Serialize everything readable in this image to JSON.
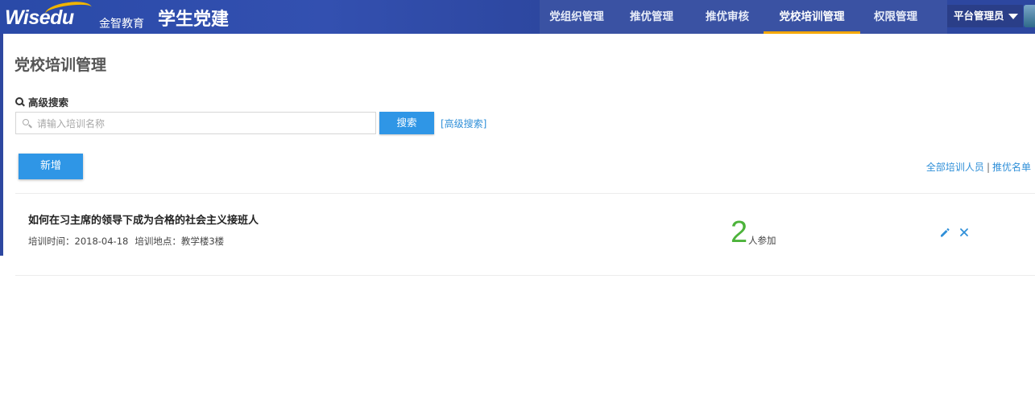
{
  "header": {
    "logo_text": "Wisedu",
    "logo_cn": "金智教育",
    "app_title": "学生党建",
    "nav": [
      {
        "label": "党组织管理",
        "active": false
      },
      {
        "label": "推优管理",
        "active": false
      },
      {
        "label": "推优审核",
        "active": false
      },
      {
        "label": "党校培训管理",
        "active": true
      },
      {
        "label": "权限管理",
        "active": false
      }
    ],
    "user": "平台管理员"
  },
  "page": {
    "title": "党校培训管理",
    "advanced_search_label": "高级搜索",
    "search_placeholder": "请输入培训名称",
    "search_button": "搜索",
    "advanced_link": "[高级搜索]",
    "add_button": "新增",
    "link_all_trainees": "全部培训人员",
    "link_separator": "|",
    "link_recommend_list": "推优名单"
  },
  "trainings": [
    {
      "title": "如何在习主席的领导下成为合格的社会主义接班人",
      "time_label": "培训时间：",
      "time": "2018-04-18",
      "place_label": "培训地点：",
      "place": "教学楼3楼",
      "count": "2",
      "count_label": "人参加"
    }
  ],
  "colors": {
    "header_bg": "#2d47a0",
    "active_underline": "#f5a800",
    "primary_button": "#2f96e6",
    "link": "#2f8fd8",
    "count_green": "#4cb33a"
  }
}
